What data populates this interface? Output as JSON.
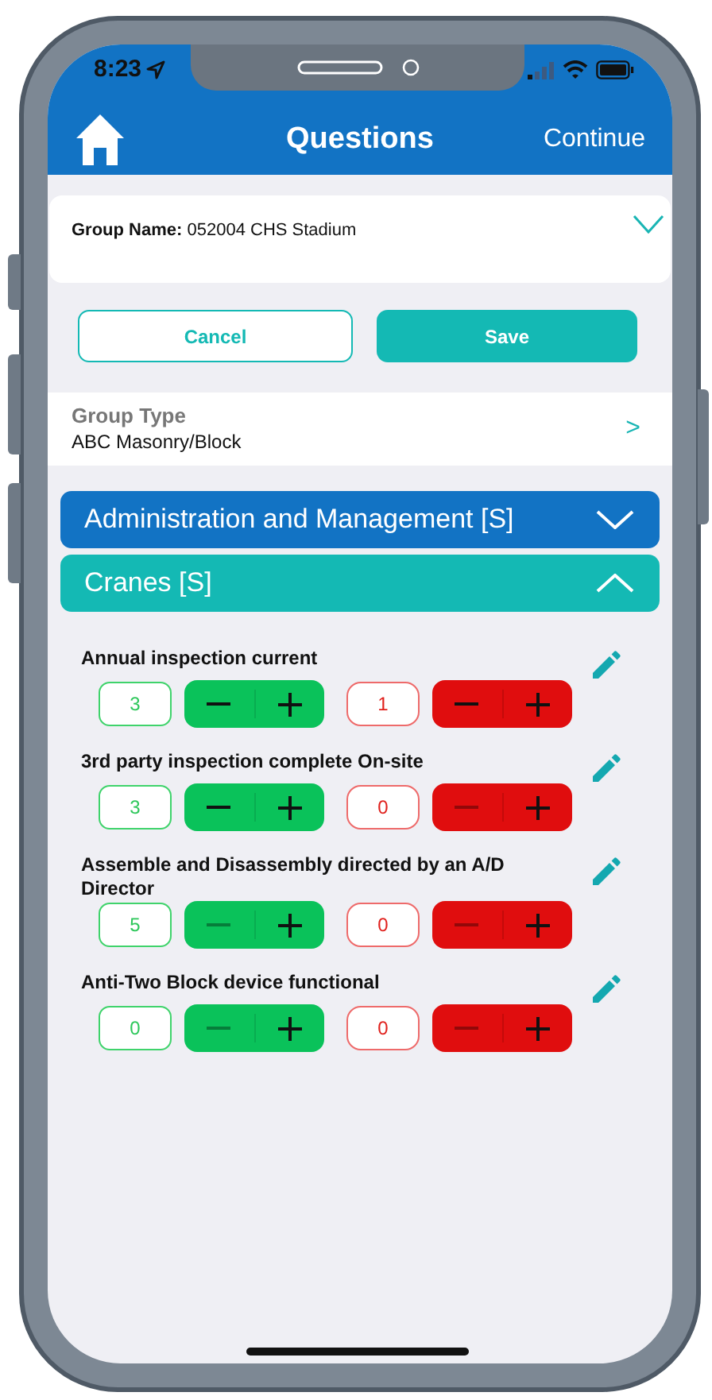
{
  "status_bar": {
    "time": "8:23"
  },
  "header": {
    "title": "Questions",
    "action": "Continue"
  },
  "group_name": {
    "label": "Group Name:",
    "value": "052004 CHS Stadium"
  },
  "buttons": [
    {
      "label": "Cancel",
      "kind": "outline"
    },
    {
      "label": "Save",
      "kind": "filled"
    }
  ],
  "group_type": {
    "label": "Group Type",
    "value": "ABC Masonry/Block",
    "indicator": ">"
  },
  "sections": [
    {
      "title": "Administration and Management [S]",
      "expanded": false,
      "color": "#1273c4"
    },
    {
      "title": "Cranes [S]",
      "expanded": true,
      "color": "#14b9b4"
    }
  ],
  "questions": [
    {
      "text": "Annual inspection current",
      "counters": [
        {
          "kind": "positive",
          "value": "3",
          "minus_disabled": false
        },
        {
          "kind": "negative",
          "value": "1",
          "minus_disabled": false
        }
      ]
    },
    {
      "text": "3rd party inspection complete On-site",
      "counters": [
        {
          "kind": "positive",
          "value": "3",
          "minus_disabled": false
        },
        {
          "kind": "negative",
          "value": "0",
          "minus_disabled": true
        }
      ]
    },
    {
      "text": "Assemble and Disassembly directed by an A/D Director",
      "counters": [
        {
          "kind": "positive",
          "value": "5",
          "minus_disabled": true
        },
        {
          "kind": "negative",
          "value": "0",
          "minus_disabled": true
        }
      ]
    },
    {
      "text": "Anti-Two Block device functional",
      "counters": [
        {
          "kind": "positive",
          "value": "0",
          "minus_disabled": true
        },
        {
          "kind": "negative",
          "value": "0",
          "minus_disabled": true
        }
      ]
    }
  ]
}
